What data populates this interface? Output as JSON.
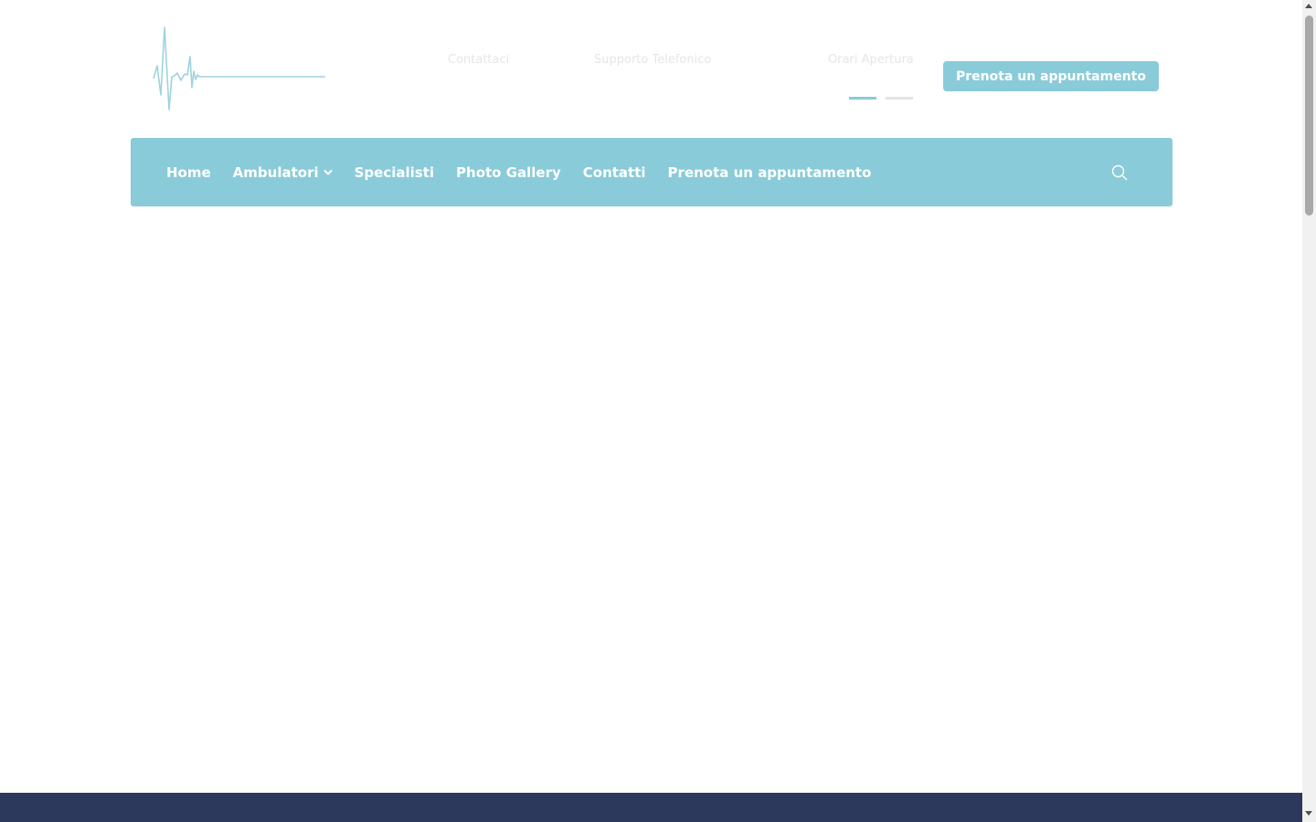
{
  "header": {
    "logo_icon": "heartbeat-line-logo",
    "info": {
      "contattaci": "Contattaci",
      "supporto": "Supporto Telefonico",
      "orari": "Orari Apertura"
    },
    "cta_label": "Prenota un appuntamento",
    "slider_dots": {
      "count": 2,
      "active_index": 0
    }
  },
  "nav": {
    "items": [
      {
        "label": "Home"
      },
      {
        "label": "Ambulatori",
        "has_dropdown": true
      },
      {
        "label": "Specialisti"
      },
      {
        "label": "Photo Gallery"
      },
      {
        "label": "Contatti"
      },
      {
        "label": "Prenota un appuntamento"
      }
    ],
    "search_icon": "search-icon"
  },
  "colors": {
    "accent": "#89cbd9",
    "footer": "#2c395d",
    "info_text": "#e6e6e6"
  }
}
